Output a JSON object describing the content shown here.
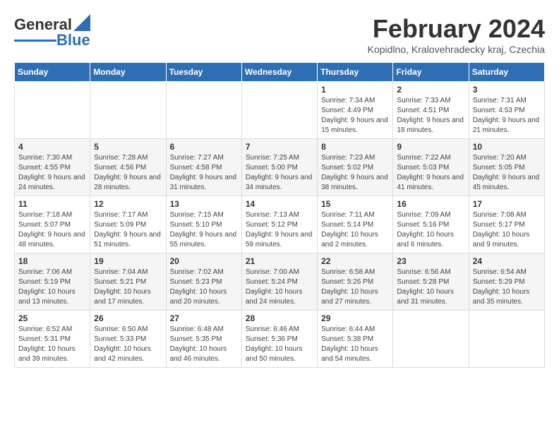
{
  "logo": {
    "line1": "General",
    "line2": "Blue"
  },
  "header": {
    "month_year": "February 2024",
    "location": "Kopidlno, Kralovehradecky kraj, Czechia"
  },
  "days_of_week": [
    "Sunday",
    "Monday",
    "Tuesday",
    "Wednesday",
    "Thursday",
    "Friday",
    "Saturday"
  ],
  "weeks": [
    [
      {
        "day": "",
        "info": ""
      },
      {
        "day": "",
        "info": ""
      },
      {
        "day": "",
        "info": ""
      },
      {
        "day": "",
        "info": ""
      },
      {
        "day": "1",
        "info": "Sunrise: 7:34 AM\nSunset: 4:49 PM\nDaylight: 9 hours\nand 15 minutes."
      },
      {
        "day": "2",
        "info": "Sunrise: 7:33 AM\nSunset: 4:51 PM\nDaylight: 9 hours\nand 18 minutes."
      },
      {
        "day": "3",
        "info": "Sunrise: 7:31 AM\nSunset: 4:53 PM\nDaylight: 9 hours\nand 21 minutes."
      }
    ],
    [
      {
        "day": "4",
        "info": "Sunrise: 7:30 AM\nSunset: 4:55 PM\nDaylight: 9 hours\nand 24 minutes."
      },
      {
        "day": "5",
        "info": "Sunrise: 7:28 AM\nSunset: 4:56 PM\nDaylight: 9 hours\nand 28 minutes."
      },
      {
        "day": "6",
        "info": "Sunrise: 7:27 AM\nSunset: 4:58 PM\nDaylight: 9 hours\nand 31 minutes."
      },
      {
        "day": "7",
        "info": "Sunrise: 7:25 AM\nSunset: 5:00 PM\nDaylight: 9 hours\nand 34 minutes."
      },
      {
        "day": "8",
        "info": "Sunrise: 7:23 AM\nSunset: 5:02 PM\nDaylight: 9 hours\nand 38 minutes."
      },
      {
        "day": "9",
        "info": "Sunrise: 7:22 AM\nSunset: 5:03 PM\nDaylight: 9 hours\nand 41 minutes."
      },
      {
        "day": "10",
        "info": "Sunrise: 7:20 AM\nSunset: 5:05 PM\nDaylight: 9 hours\nand 45 minutes."
      }
    ],
    [
      {
        "day": "11",
        "info": "Sunrise: 7:18 AM\nSunset: 5:07 PM\nDaylight: 9 hours\nand 48 minutes."
      },
      {
        "day": "12",
        "info": "Sunrise: 7:17 AM\nSunset: 5:09 PM\nDaylight: 9 hours\nand 51 minutes."
      },
      {
        "day": "13",
        "info": "Sunrise: 7:15 AM\nSunset: 5:10 PM\nDaylight: 9 hours\nand 55 minutes."
      },
      {
        "day": "14",
        "info": "Sunrise: 7:13 AM\nSunset: 5:12 PM\nDaylight: 9 hours\nand 59 minutes."
      },
      {
        "day": "15",
        "info": "Sunrise: 7:11 AM\nSunset: 5:14 PM\nDaylight: 10 hours\nand 2 minutes."
      },
      {
        "day": "16",
        "info": "Sunrise: 7:09 AM\nSunset: 5:16 PM\nDaylight: 10 hours\nand 6 minutes."
      },
      {
        "day": "17",
        "info": "Sunrise: 7:08 AM\nSunset: 5:17 PM\nDaylight: 10 hours\nand 9 minutes."
      }
    ],
    [
      {
        "day": "18",
        "info": "Sunrise: 7:06 AM\nSunset: 5:19 PM\nDaylight: 10 hours\nand 13 minutes."
      },
      {
        "day": "19",
        "info": "Sunrise: 7:04 AM\nSunset: 5:21 PM\nDaylight: 10 hours\nand 17 minutes."
      },
      {
        "day": "20",
        "info": "Sunrise: 7:02 AM\nSunset: 5:23 PM\nDaylight: 10 hours\nand 20 minutes."
      },
      {
        "day": "21",
        "info": "Sunrise: 7:00 AM\nSunset: 5:24 PM\nDaylight: 10 hours\nand 24 minutes."
      },
      {
        "day": "22",
        "info": "Sunrise: 6:58 AM\nSunset: 5:26 PM\nDaylight: 10 hours\nand 27 minutes."
      },
      {
        "day": "23",
        "info": "Sunrise: 6:56 AM\nSunset: 5:28 PM\nDaylight: 10 hours\nand 31 minutes."
      },
      {
        "day": "24",
        "info": "Sunrise: 6:54 AM\nSunset: 5:29 PM\nDaylight: 10 hours\nand 35 minutes."
      }
    ],
    [
      {
        "day": "25",
        "info": "Sunrise: 6:52 AM\nSunset: 5:31 PM\nDaylight: 10 hours\nand 39 minutes."
      },
      {
        "day": "26",
        "info": "Sunrise: 6:50 AM\nSunset: 5:33 PM\nDaylight: 10 hours\nand 42 minutes."
      },
      {
        "day": "27",
        "info": "Sunrise: 6:48 AM\nSunset: 5:35 PM\nDaylight: 10 hours\nand 46 minutes."
      },
      {
        "day": "28",
        "info": "Sunrise: 6:46 AM\nSunset: 5:36 PM\nDaylight: 10 hours\nand 50 minutes."
      },
      {
        "day": "29",
        "info": "Sunrise: 6:44 AM\nSunset: 5:38 PM\nDaylight: 10 hours\nand 54 minutes."
      },
      {
        "day": "",
        "info": ""
      },
      {
        "day": "",
        "info": ""
      }
    ]
  ]
}
